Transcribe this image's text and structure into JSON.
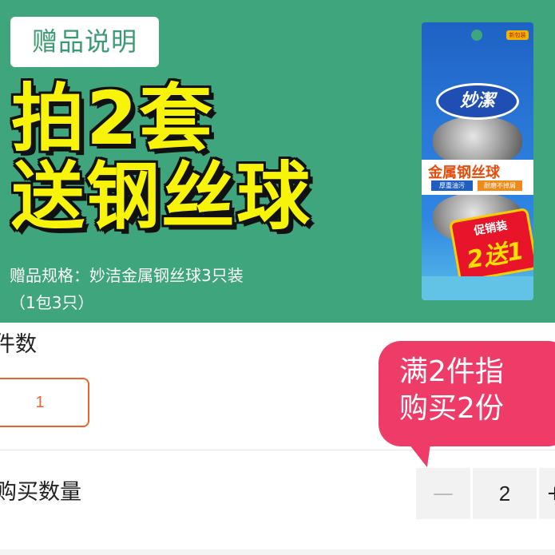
{
  "banner": {
    "gift_tag": "赠品说明",
    "promo_line1": "拍2套",
    "promo_line2": "送钢丝球",
    "spec_line1": "赠品规格：妙洁金属钢丝球3只装",
    "spec_line2": "（1包3只）",
    "background_color": "#3ea57c",
    "promo_text_color": "#f7f40a"
  },
  "product_pack": {
    "brand": "妙潔",
    "title": "金属钢丝球",
    "tag_left": "厚重油污",
    "tag_right": "耐磨不掉屑",
    "promo_top": "促销装",
    "promo_main": "2送1",
    "corner_badge": "新包装"
  },
  "order": {
    "quantity_label": "件数",
    "quantity_value": "1",
    "buy_quantity_label": "购买数量",
    "stepper_minus": "—",
    "stepper_value": "2",
    "stepper_plus": "+",
    "tip_line1": "满2件指",
    "tip_line2": "购买2份",
    "accent_color": "#e8642c",
    "tip_color": "#ef3b67"
  }
}
